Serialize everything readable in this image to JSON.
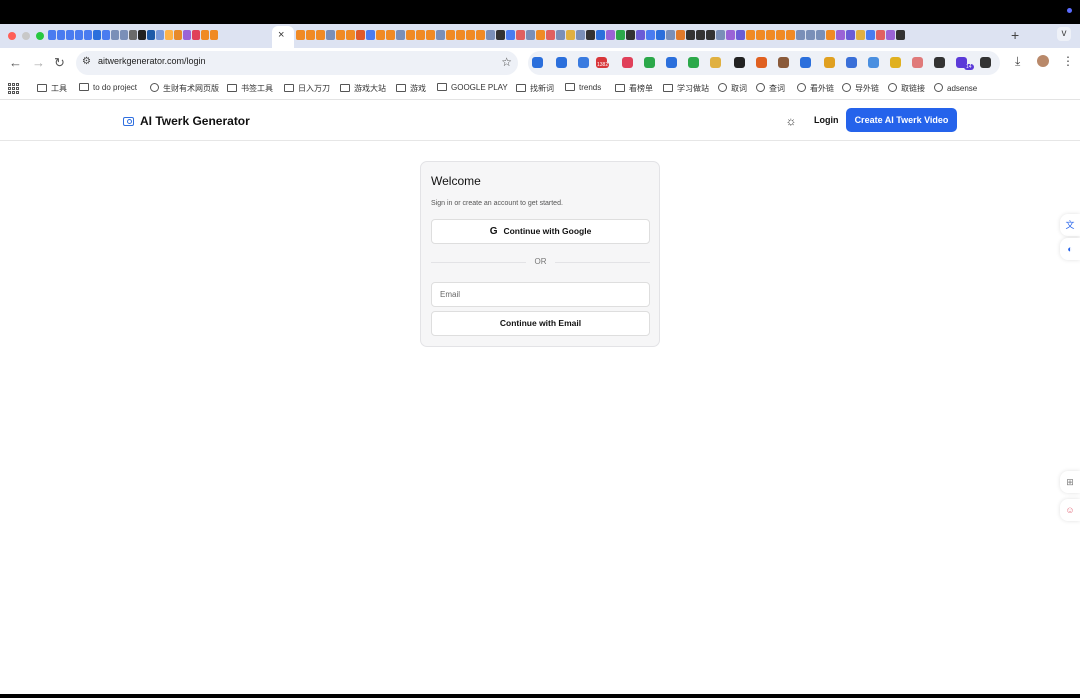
{
  "browser": {
    "close_tab_glyph": "×",
    "new_tab_glyph": "+",
    "tab_list_glyph": "v",
    "url": "aitwerkgenerator.com/login",
    "icons": {
      "back": "arrow-left-icon",
      "forward": "arrow-right-icon",
      "reload": "reload-icon",
      "star": "star-icon",
      "download": "download-icon",
      "menu": "kebab-menu-icon"
    },
    "extension_badge_1": "1382",
    "extension_badge_2": "14"
  },
  "bookmarks": [
    {
      "label": "工具",
      "type": "folder"
    },
    {
      "label": "to do project",
      "type": "folder"
    },
    {
      "label": "生财有术网页版",
      "type": "globe"
    },
    {
      "label": "书签工具",
      "type": "folder"
    },
    {
      "label": "日入万刀",
      "type": "folder"
    },
    {
      "label": "游戏大站",
      "type": "folder"
    },
    {
      "label": "游戏",
      "type": "folder"
    },
    {
      "label": "GOOGLE PLAY",
      "type": "folder"
    },
    {
      "label": "找新词",
      "type": "folder"
    },
    {
      "label": "trends",
      "type": "folder"
    },
    {
      "label": "看榜单",
      "type": "folder"
    },
    {
      "label": "学习做站",
      "type": "folder"
    },
    {
      "label": "取词",
      "type": "globe"
    },
    {
      "label": "查词",
      "type": "globe"
    },
    {
      "label": "看外链",
      "type": "globe"
    },
    {
      "label": "导外链",
      "type": "globe"
    },
    {
      "label": "取链接",
      "type": "globe"
    },
    {
      "label": "adsense",
      "type": "globe"
    }
  ],
  "header": {
    "logo_text": "AI Twerk Generator",
    "theme_icon": "sun-icon",
    "login_label": "Login",
    "cta_label": "Create AI Twerk Video",
    "accent_color": "#2563eb"
  },
  "login_card": {
    "title": "Welcome",
    "subtitle": "Sign in or create an account to get started.",
    "google_button_label": "Continue with Google",
    "divider_text": "OR",
    "email_placeholder": "Email",
    "email_button_label": "Continue with Email"
  },
  "floating": {
    "translate_icon": "translate-icon",
    "assistant_icon": "assistant-icon",
    "apps_icon": "apps-add-icon",
    "avatar_icon": "avatar-icon"
  }
}
